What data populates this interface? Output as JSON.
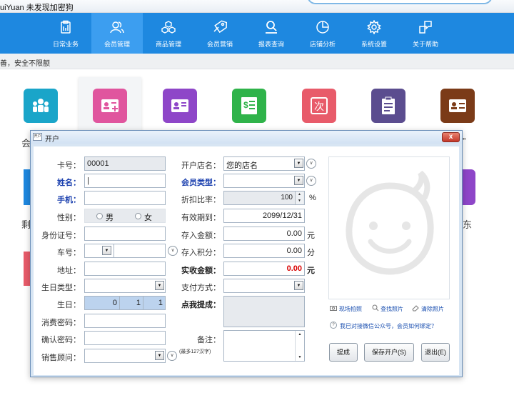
{
  "app": {
    "title": "uiYuan   未发现加密狗"
  },
  "notice": "善，安全不限额",
  "nav": [
    {
      "label": "日常业务",
      "icon": "clipboard-icon"
    },
    {
      "label": "会员管理",
      "icon": "members-icon"
    },
    {
      "label": "商品管理",
      "icon": "cubes-icon"
    },
    {
      "label": "会员营销",
      "icon": "tag-icon"
    },
    {
      "label": "报表查询",
      "icon": "report-search-icon"
    },
    {
      "label": "店铺分析",
      "icon": "pie-chart-icon"
    },
    {
      "label": "系统设置",
      "icon": "gear-icon"
    },
    {
      "label": "关于帮助",
      "icon": "help-icon"
    }
  ],
  "tiles": [
    {
      "color": "#1aa5c9",
      "icon": "group-icon"
    },
    {
      "color": "#e0559e",
      "icon": "add-member-card-icon"
    },
    {
      "color": "#8e46c8",
      "icon": "member-card-icon"
    },
    {
      "color": "#2fb34a",
      "icon": "money-list-icon"
    },
    {
      "color": "#e85b6a",
      "icon": "times-icon"
    },
    {
      "color": "#5b4d8f",
      "icon": "clipboard-list-icon"
    },
    {
      "color": "#7b3b18",
      "icon": "card-remove-icon"
    }
  ],
  "bg_fragments": {
    "left1": "会",
    "right1": "”",
    "left2": "剩",
    "right2": "东"
  },
  "dialog": {
    "title": "开户",
    "icon_text": "开户",
    "close_label": "x",
    "fields": {
      "card_no_label": "卡号：",
      "card_no": "00001",
      "name_label": "姓名：",
      "name": "|",
      "phone_label": "手机：",
      "phone": "",
      "gender_label": "性别：",
      "male": "男",
      "female": "女",
      "id_label": "身份证号：",
      "id_value": "",
      "car_label": "车号：",
      "address_label": "地址：",
      "birth_type_label": "生日类型：",
      "birthday_label": "生日：",
      "birth_y": "0",
      "birth_m": "1",
      "birth_d": "1",
      "pwd_label": "消费密码：",
      "pwd_confirm_label": "确认密码：",
      "advisor_label": "销售顾问：",
      "store_label": "开户店名：",
      "store": "您的店名",
      "member_type_label": "会员类型：",
      "discount_label": "折扣比率：",
      "discount": "100",
      "discount_unit": "%",
      "expiry_label": "有效期到：",
      "expiry": "2099/12/31",
      "deposit_label": "存入金额：",
      "deposit": "0.00",
      "deposit_unit": "元",
      "points_label": "存入积分：",
      "points": "0.00",
      "points_unit": "分",
      "actual_label": "实收金额：",
      "actual": "0.00",
      "actual_unit": "元",
      "pay_label": "支付方式：",
      "commission_label": "点我提成：",
      "remark_label": "备注：",
      "remark_hint": "(最多127汉字)"
    },
    "photo_links": {
      "capture": "现场拍照",
      "find": "查找照片",
      "clear": "清除照片",
      "wechat": "我已对接微信公众号，会员如何绑定？"
    },
    "buttons": {
      "commission": "提成",
      "save": "保存开户(S)",
      "exit": "退出(E)"
    }
  },
  "colors": {
    "nav_bg": "#1e88e0",
    "accent_red": "#d90000",
    "label_blue": "#1a3fae"
  }
}
